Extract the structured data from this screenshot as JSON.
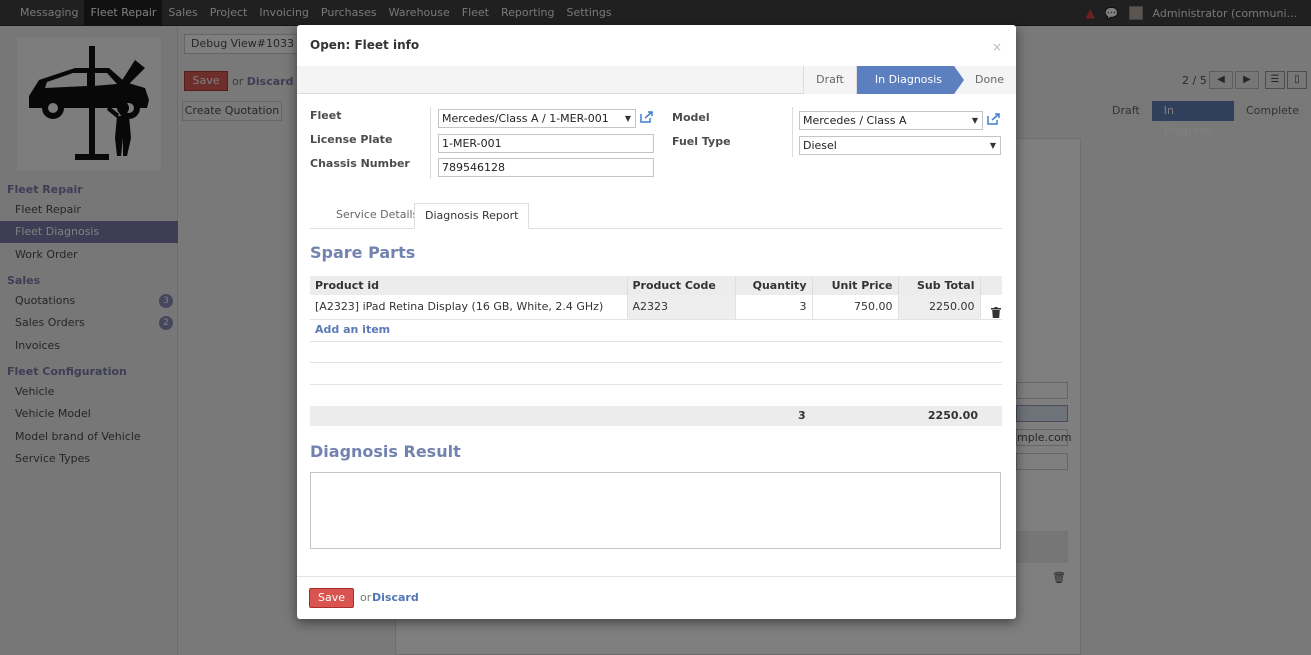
{
  "topbar": {
    "menu": [
      "Messaging",
      "Fleet Repair",
      "Sales",
      "Project",
      "Invoicing",
      "Purchases",
      "Warehouse",
      "Fleet",
      "Reporting",
      "Settings"
    ],
    "active_menu": "Fleet Repair",
    "user": "Administrator (communi..."
  },
  "sidebar": {
    "sections": [
      {
        "title": "Fleet Repair",
        "items": [
          {
            "label": "Fleet Repair"
          },
          {
            "label": "Fleet Diagnosis",
            "active": true
          },
          {
            "label": "Work Order"
          }
        ]
      },
      {
        "title": "Sales",
        "items": [
          {
            "label": "Quotations",
            "badge": "3"
          },
          {
            "label": "Sales Orders",
            "badge": "2"
          },
          {
            "label": "Invoices"
          }
        ]
      },
      {
        "title": "Fleet Configuration",
        "items": [
          {
            "label": "Vehicle"
          },
          {
            "label": "Vehicle Model"
          },
          {
            "label": "Model brand of Vehicle"
          },
          {
            "label": "Service Types"
          }
        ]
      }
    ]
  },
  "background": {
    "debug": "Debug View#1033",
    "save": "Save",
    "or": "or",
    "discard": "Discard",
    "create_quotation": "Create Quotation",
    "pager": "2 / 5",
    "stages": [
      "Draft",
      "In Progress",
      "Complete"
    ],
    "current_stage": "In Progress",
    "email_fragment": "mple.com"
  },
  "modal": {
    "title": "Open: Fleet info",
    "close": "×",
    "stages": [
      "Draft",
      "In Diagnosis",
      "Done"
    ],
    "current_stage": "In Diagnosis",
    "fields": {
      "fleet_label": "Fleet",
      "fleet_value": "Mercedes/Class A / 1-MER-001",
      "license_label": "License Plate",
      "license_value": "1-MER-001",
      "chassis_label": "Chassis Number",
      "chassis_value": "789546128",
      "model_label": "Model",
      "model_value": "Mercedes / Class A",
      "fuel_label": "Fuel Type",
      "fuel_value": "Diesel"
    },
    "tabs": [
      "Service Details",
      "Diagnosis Report"
    ],
    "active_tab": "Diagnosis Report",
    "spare_parts_title": "Spare Parts",
    "parts_columns": [
      "Product id",
      "Product Code",
      "Quantity",
      "Unit Price",
      "Sub Total"
    ],
    "parts_rows": [
      {
        "product": "[A2323] iPad Retina Display (16 GB, White, 2.4 GHz)",
        "code": "A2323",
        "qty": "3",
        "price": "750.00",
        "subtotal": "2250.00"
      }
    ],
    "add_item": "Add an item",
    "total_qty": "3",
    "total_amount": "2250.00",
    "diagnosis_title": "Diagnosis Result",
    "diagnosis_value": "",
    "save": "Save",
    "or": "or",
    "discard": "Discard"
  },
  "colors": {
    "accent": "#7c7bad",
    "stage_active": "#5b7fbf",
    "save_red": "#d9534f",
    "link_blue": "#4f76b6"
  }
}
